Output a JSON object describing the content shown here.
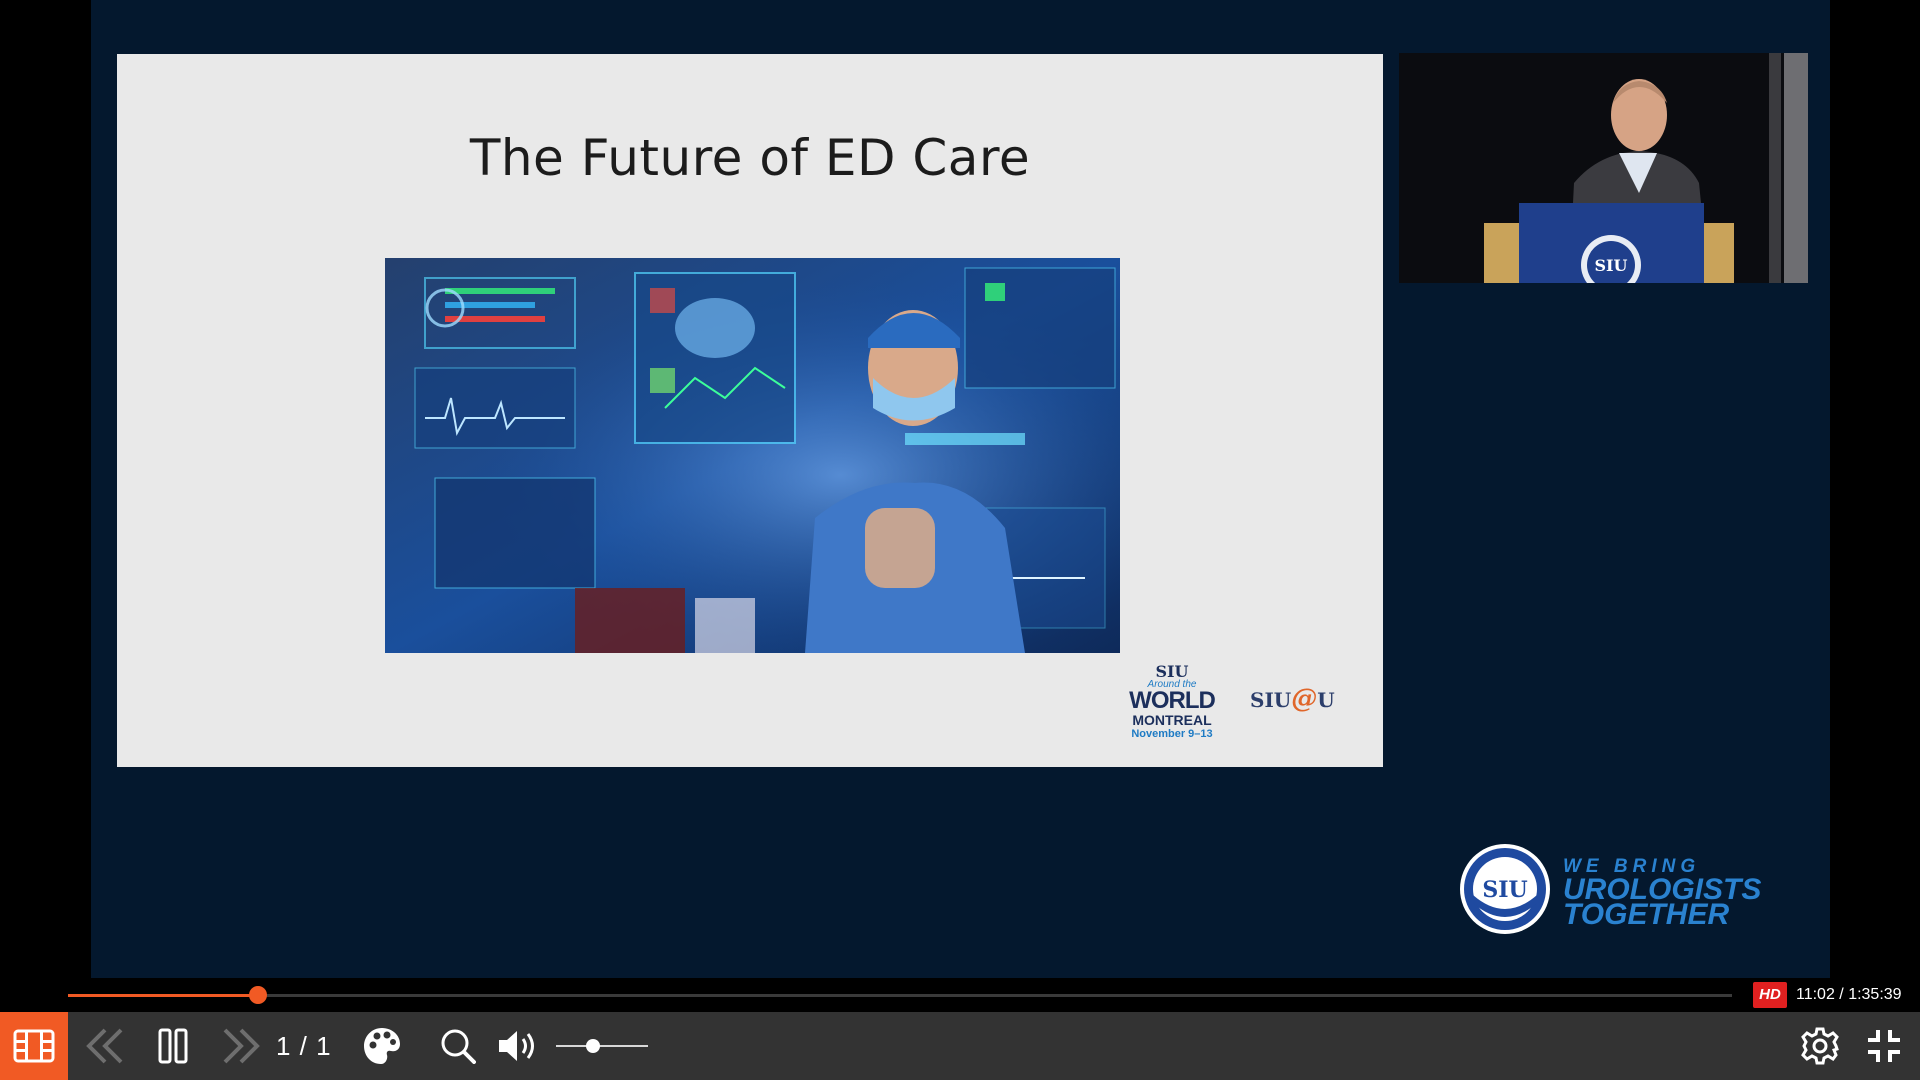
{
  "slide": {
    "title": "The Future of ED Care",
    "logo_world": {
      "line1": "SIU",
      "line2": "Around the",
      "line3": "WORLD",
      "line4": "MONTREAL",
      "line5": "November 9–13"
    },
    "logo_siu_u": {
      "left": "SIU",
      "at": "@",
      "right": "U"
    }
  },
  "branding": {
    "badge_text": "SIU",
    "tagline_1": "WE BRING",
    "tagline_2": "UROLOGISTS",
    "tagline_3": "TOGETHER"
  },
  "player": {
    "progress_fraction": 0.114,
    "hd_label": "HD",
    "time": "11:02 / 1:35:39",
    "page_counter": "1 / 1",
    "volume_fraction": 0.4,
    "accent_color": "#f15a24",
    "controls": {
      "slides_icon": "slides-icon",
      "prev_icon": "double-chevron-left-icon",
      "pause_icon": "pause-icon",
      "next_icon": "double-chevron-right-icon",
      "theme_icon": "palette-icon",
      "zoom_icon": "magnifier-icon",
      "volume_icon": "speaker-icon",
      "settings_icon": "gear-icon",
      "exit_fullscreen_icon": "exit-fullscreen-icon"
    }
  }
}
